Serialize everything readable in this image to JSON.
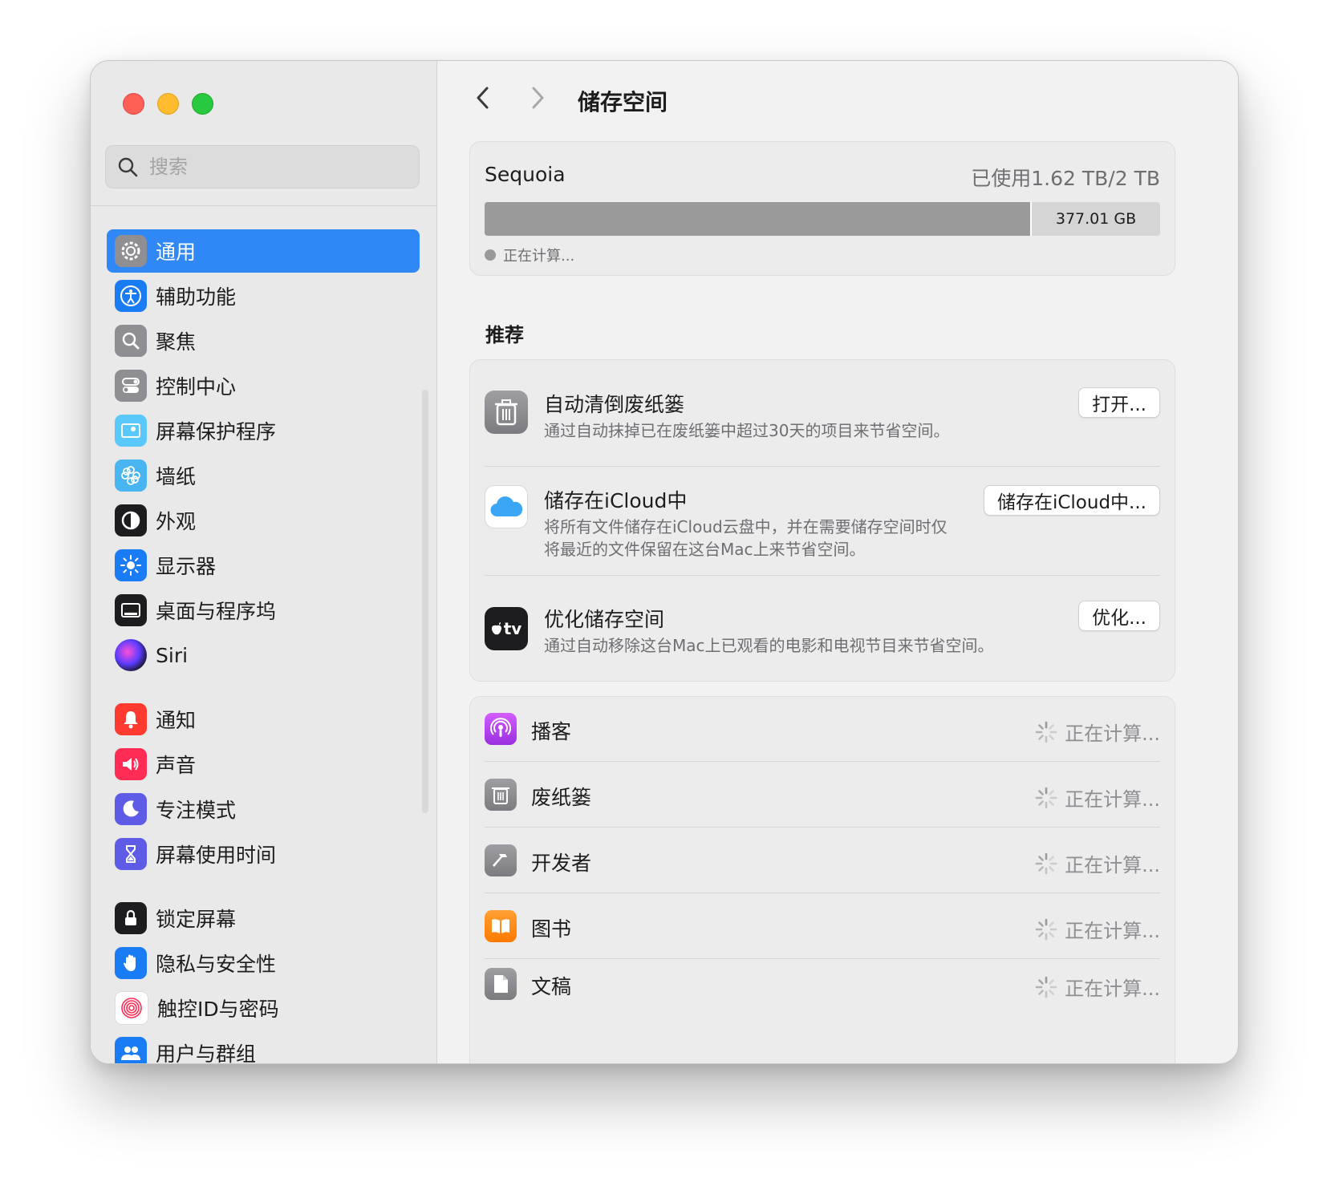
{
  "window": {
    "title": "储存空间"
  },
  "sidebar": {
    "search_placeholder": "搜索",
    "items": [
      {
        "label": "通用",
        "icon": "gear-icon",
        "active": true
      },
      {
        "label": "辅助功能",
        "icon": "accessibility-icon"
      },
      {
        "label": "聚焦",
        "icon": "spotlight-icon"
      },
      {
        "label": "控制中心",
        "icon": "control-center-icon"
      },
      {
        "label": "屏幕保护程序",
        "icon": "screensaver-icon"
      },
      {
        "label": "墙纸",
        "icon": "wallpaper-icon"
      },
      {
        "label": "外观",
        "icon": "appearance-icon"
      },
      {
        "label": "显示器",
        "icon": "display-icon"
      },
      {
        "label": "桌面与程序坞",
        "icon": "dock-icon"
      },
      {
        "label": "Siri",
        "icon": "siri-icon"
      },
      {
        "label": "通知",
        "icon": "notifications-icon"
      },
      {
        "label": "声音",
        "icon": "sound-icon"
      },
      {
        "label": "专注模式",
        "icon": "focus-icon"
      },
      {
        "label": "屏幕使用时间",
        "icon": "screen-time-icon"
      },
      {
        "label": "锁定屏幕",
        "icon": "lock-screen-icon"
      },
      {
        "label": "隐私与安全性",
        "icon": "privacy-hand-icon"
      },
      {
        "label": "触控ID与密码",
        "icon": "touch-id-icon"
      },
      {
        "label": "用户与群组",
        "icon": "users-icon"
      }
    ]
  },
  "storage": {
    "disk_name": "Sequoia",
    "usage_text": "已使用1.62 TB/2 TB",
    "used_fraction": 0.81,
    "free_label": "377.01 GB",
    "legend_label": "正在计算..."
  },
  "recommendations": {
    "heading": "推荐",
    "items": [
      {
        "title": "自动清倒废纸篓",
        "description": "通过自动抹掉已在废纸篓中超过30天的项目来节省空间。",
        "button": "打开...",
        "icon": "trash-icon"
      },
      {
        "title": "储存在iCloud中",
        "description": "将所有文件储存在iCloud云盘中，并在需要储存空间时仅将最近的文件保留在这台Mac上来节省空间。",
        "button": "储存在iCloud中...",
        "icon": "icloud-icon"
      },
      {
        "title": "优化储存空间",
        "description": "通过自动移除这台Mac上已观看的电影和电视节目来节省空间。",
        "button": "优化...",
        "icon": "apple-tv-icon",
        "icon_text": "tv"
      }
    ]
  },
  "categories": {
    "items": [
      {
        "label": "播客",
        "status": "正在计算...",
        "icon": "podcasts-icon"
      },
      {
        "label": "废纸篓",
        "status": "正在计算...",
        "icon": "trash-icon"
      },
      {
        "label": "开发者",
        "status": "正在计算...",
        "icon": "hammer-icon"
      },
      {
        "label": "图书",
        "status": "正在计算...",
        "icon": "books-icon"
      },
      {
        "label": "文稿",
        "status": "正在计算...",
        "icon": "document-icon"
      }
    ]
  },
  "colors": {
    "accent": "#2f88f5",
    "bar_used": "#9a9a9a",
    "bar_free": "#d5d5d5"
  }
}
